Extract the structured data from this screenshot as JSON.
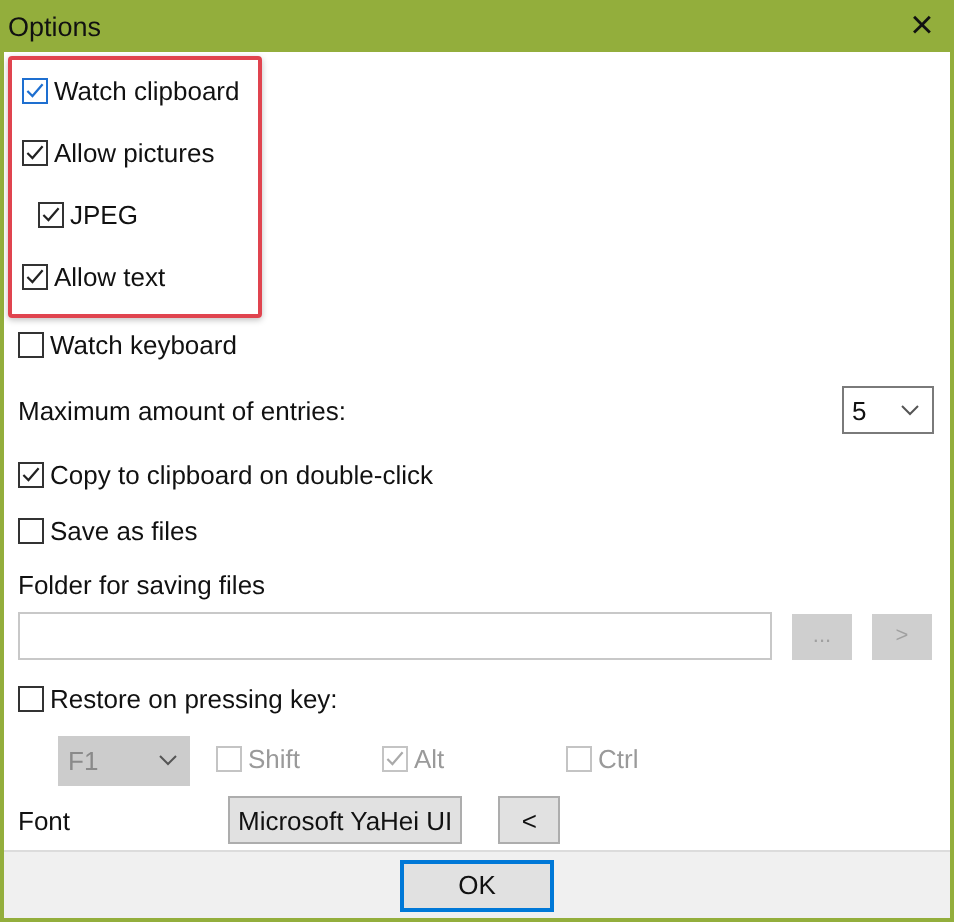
{
  "window": {
    "title": "Options",
    "close": "×"
  },
  "highlighted_options": [
    {
      "label": "Watch clipboard",
      "checked": true,
      "focused": true
    },
    {
      "label": "Allow pictures",
      "checked": true,
      "focused": false,
      "children": [
        {
          "label": "JPEG",
          "checked": true,
          "focused": false
        }
      ]
    },
    {
      "label": "Allow text",
      "checked": true,
      "focused": false
    }
  ],
  "watch_keyboard": {
    "label": "Watch keyboard",
    "checked": false
  },
  "max_entries": {
    "label": "Maximum amount of entries:",
    "value": "5"
  },
  "copy_on_double_click": {
    "label": "Copy to clipboard on double-click",
    "checked": true
  },
  "save_as_files": {
    "label": "Save as files",
    "checked": false
  },
  "folder": {
    "label": "Folder for saving files",
    "browse_button": "...",
    "open_button": ">",
    "buttons_disabled": true
  },
  "restore_on_key": {
    "label": "Restore on pressing key:",
    "checked": false
  },
  "key_combo": {
    "disabled": true,
    "key": "F1",
    "modifiers": [
      {
        "label": "Shift",
        "checked": false
      },
      {
        "label": "Alt",
        "checked": true
      },
      {
        "label": "Ctrl",
        "checked": false
      }
    ]
  },
  "font": {
    "label": "Font",
    "value": "Microsoft YaHei UI",
    "reset_button": "<"
  },
  "buttons": [
    "OK"
  ]
}
